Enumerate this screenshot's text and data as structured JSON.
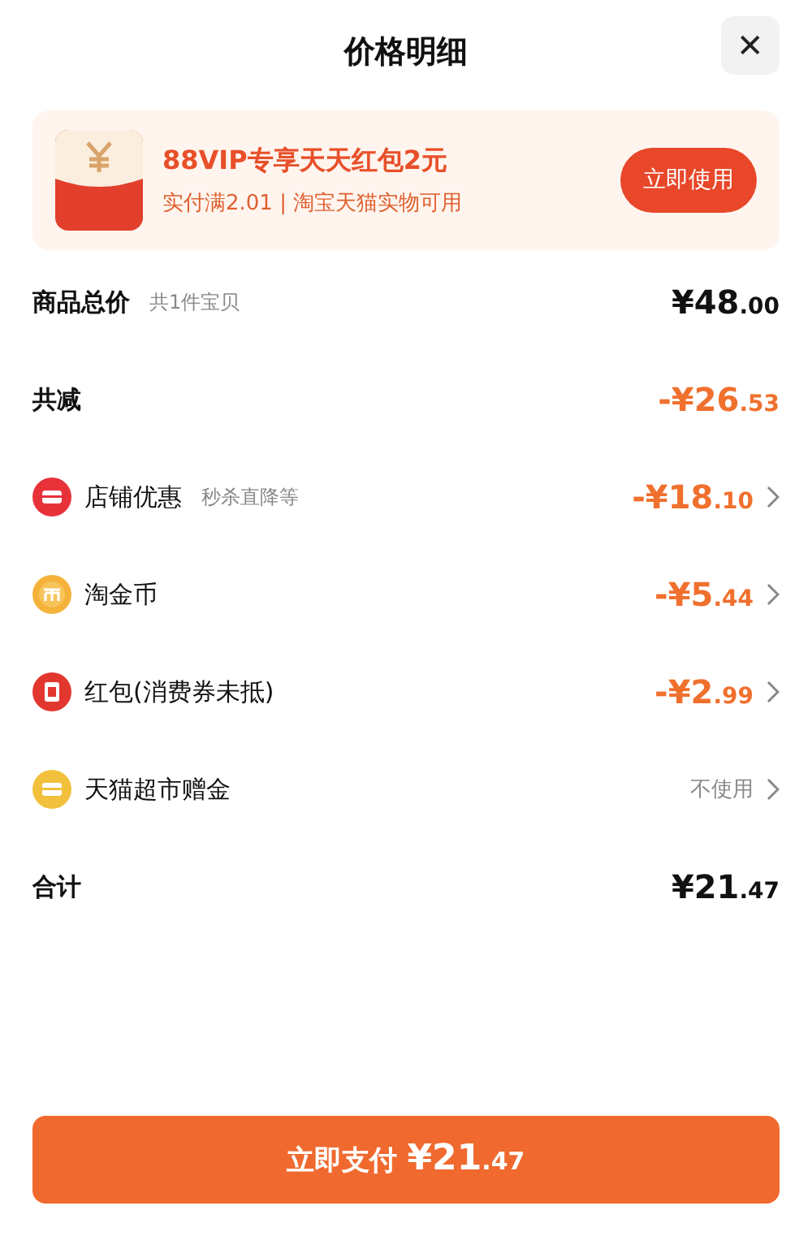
{
  "header": {
    "title": "价格明细",
    "close": "✕"
  },
  "promo": {
    "title": "88VIP专享天天红包2元",
    "subtitle": "实付满2.01 | 淘宝天猫实物可用",
    "button": "立即使用"
  },
  "rows": [
    {
      "kind": "total",
      "label": "商品总价",
      "note": "共1件宝贝",
      "amount": "¥48.00"
    },
    {
      "kind": "summary",
      "label": "共减",
      "amount": "-¥26.53"
    },
    {
      "kind": "store",
      "label": "店铺优惠",
      "note": "秒杀直降等",
      "amount": "-¥18.10"
    },
    {
      "kind": "coins",
      "label": "淘金币",
      "amount": "-¥5.44"
    },
    {
      "kind": "packet",
      "label": "红包(消费券未抵)",
      "amount": "-¥2.99"
    },
    {
      "kind": "voucher",
      "label": "天猫超市赠金",
      "value": "不使用"
    },
    {
      "kind": "total",
      "label": "合计",
      "amount": "¥21.47"
    }
  ],
  "pay_button": {
    "label": "立即支付",
    "amount": "¥21.47"
  }
}
